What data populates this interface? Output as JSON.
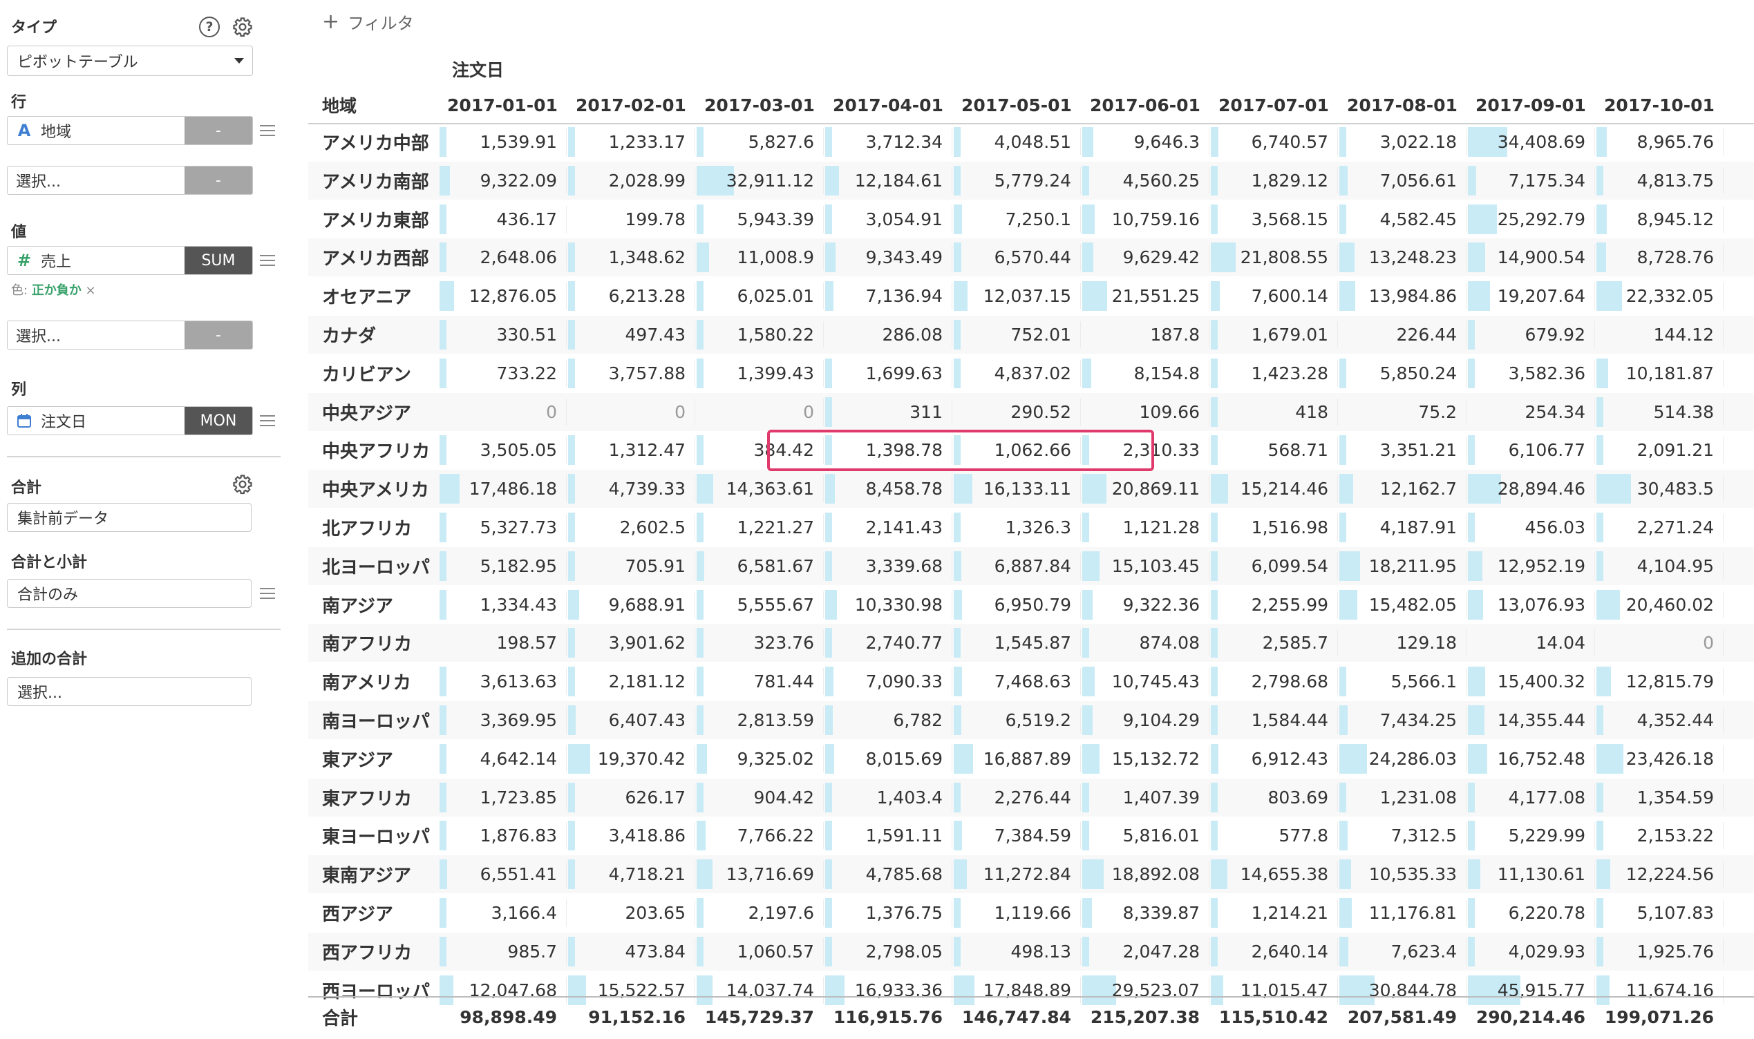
{
  "sidebar": {
    "type": {
      "label": "タイプ",
      "value": "ピボットテーブル"
    },
    "rows": {
      "label": "行",
      "field": "地域",
      "field_icon": "A",
      "field_btn": "-",
      "select_placeholder": "選択...",
      "select_btn": "-"
    },
    "values": {
      "label": "値",
      "field": "売上",
      "field_icon": "#",
      "agg": "SUM",
      "color_prefix": "色:",
      "color_value": "正か負か",
      "color_remove": "×",
      "select_placeholder": "選択...",
      "select_btn": "-"
    },
    "columns": {
      "label": "列",
      "field": "注文日",
      "agg": "MON"
    },
    "total": {
      "label": "合計",
      "value": "集計前データ"
    },
    "subtotal": {
      "label": "合計と小計",
      "value": "合計のみ"
    },
    "extra": {
      "label": "追加の合計",
      "placeholder": "選択..."
    },
    "help_glyph": "?"
  },
  "main": {
    "filter_label": "フィルタ",
    "filter_plus": "+",
    "column_group_label": "注文日",
    "row_header_label": "地域",
    "columns": [
      "2017-01-01",
      "2017-02-01",
      "2017-03-01",
      "2017-04-01",
      "2017-05-01",
      "2017-06-01",
      "2017-07-01",
      "2017-08-01",
      "2017-09-01",
      "2017-10-01"
    ],
    "rows": [
      {
        "name": "アメリカ中部",
        "values": [
          "1,539.91",
          "1,233.17",
          "5,827.6",
          "3,712.34",
          "4,048.51",
          "9,646.3",
          "6,740.57",
          "3,022.18",
          "34,408.69",
          "8,965.76"
        ]
      },
      {
        "name": "アメリカ南部",
        "values": [
          "9,322.09",
          "2,028.99",
          "32,911.12",
          "12,184.61",
          "5,779.24",
          "4,560.25",
          "1,829.12",
          "7,056.61",
          "7,175.34",
          "4,813.75"
        ]
      },
      {
        "name": "アメリカ東部",
        "values": [
          "436.17",
          "199.78",
          "5,943.39",
          "3,054.91",
          "7,250.1",
          "10,759.16",
          "3,568.15",
          "4,582.45",
          "25,292.79",
          "8,945.12"
        ]
      },
      {
        "name": "アメリカ西部",
        "values": [
          "2,648.06",
          "1,348.62",
          "11,008.9",
          "9,343.49",
          "6,570.44",
          "9,629.42",
          "21,808.55",
          "13,248.23",
          "14,900.54",
          "8,728.76"
        ]
      },
      {
        "name": "オセアニア",
        "values": [
          "12,876.05",
          "6,213.28",
          "6,025.01",
          "7,136.94",
          "12,037.15",
          "21,551.25",
          "7,600.14",
          "13,984.86",
          "19,207.64",
          "22,332.05"
        ]
      },
      {
        "name": "カナダ",
        "values": [
          "330.51",
          "497.43",
          "1,580.22",
          "286.08",
          "752.01",
          "187.8",
          "1,679.01",
          "226.44",
          "679.92",
          "144.12"
        ]
      },
      {
        "name": "カリビアン",
        "values": [
          "733.22",
          "3,757.88",
          "1,399.43",
          "1,699.63",
          "4,837.02",
          "8,154.8",
          "1,423.28",
          "5,850.24",
          "3,582.36",
          "10,181.87"
        ]
      },
      {
        "name": "中央アジア",
        "values": [
          "0",
          "0",
          "0",
          "311",
          "290.52",
          "109.66",
          "418",
          "75.2",
          "254.34",
          "514.38"
        ]
      },
      {
        "name": "中央アフリカ",
        "values": [
          "3,505.05",
          "1,312.47",
          "384.42",
          "1,398.78",
          "1,062.66",
          "2,310.33",
          "568.71",
          "3,351.21",
          "6,106.77",
          "2,091.21"
        ]
      },
      {
        "name": "中央アメリカ",
        "values": [
          "17,486.18",
          "4,739.33",
          "14,363.61",
          "8,458.78",
          "16,133.11",
          "20,869.11",
          "15,214.46",
          "12,162.7",
          "28,894.46",
          "30,483.5"
        ]
      },
      {
        "name": "北アフリカ",
        "values": [
          "5,327.73",
          "2,602.5",
          "1,221.27",
          "2,141.43",
          "1,326.3",
          "1,121.28",
          "1,516.98",
          "4,187.91",
          "456.03",
          "2,271.24"
        ]
      },
      {
        "name": "北ヨーロッパ",
        "values": [
          "5,182.95",
          "705.91",
          "6,581.67",
          "3,339.68",
          "6,887.84",
          "15,103.45",
          "6,099.54",
          "18,211.95",
          "12,952.19",
          "4,104.95"
        ]
      },
      {
        "name": "南アジア",
        "values": [
          "1,334.43",
          "9,688.91",
          "5,555.67",
          "10,330.98",
          "6,950.79",
          "9,322.36",
          "2,255.99",
          "15,482.05",
          "13,076.93",
          "20,460.02"
        ]
      },
      {
        "name": "南アフリカ",
        "values": [
          "198.57",
          "3,901.62",
          "323.76",
          "2,740.77",
          "1,545.87",
          "874.08",
          "2,585.7",
          "129.18",
          "14.04",
          "0"
        ]
      },
      {
        "name": "南アメリカ",
        "values": [
          "3,613.63",
          "2,181.12",
          "781.44",
          "7,090.33",
          "7,468.63",
          "10,745.43",
          "2,798.68",
          "5,566.1",
          "15,400.32",
          "12,815.79"
        ]
      },
      {
        "name": "南ヨーロッパ",
        "values": [
          "3,369.95",
          "6,407.43",
          "2,813.59",
          "6,782",
          "6,519.2",
          "9,104.29",
          "1,584.44",
          "7,434.25",
          "14,355.44",
          "4,352.44"
        ]
      },
      {
        "name": "東アジア",
        "values": [
          "4,642.14",
          "19,370.42",
          "9,325.02",
          "8,015.69",
          "16,887.89",
          "15,132.72",
          "6,912.43",
          "24,286.03",
          "16,752.48",
          "23,426.18"
        ]
      },
      {
        "name": "東アフリカ",
        "values": [
          "1,723.85",
          "626.17",
          "904.42",
          "1,403.4",
          "2,276.44",
          "1,407.39",
          "803.69",
          "1,231.08",
          "4,177.08",
          "1,354.59"
        ]
      },
      {
        "name": "東ヨーロッパ",
        "values": [
          "1,876.83",
          "3,418.86",
          "7,766.22",
          "1,591.11",
          "7,384.59",
          "5,816.01",
          "577.8",
          "7,312.5",
          "5,229.99",
          "2,153.22"
        ]
      },
      {
        "name": "東南アジア",
        "values": [
          "6,551.41",
          "4,718.21",
          "13,716.69",
          "4,785.68",
          "11,272.84",
          "18,892.08",
          "14,655.38",
          "10,535.33",
          "11,130.61",
          "12,224.56"
        ]
      },
      {
        "name": "西アジア",
        "values": [
          "3,166.4",
          "203.65",
          "2,197.6",
          "1,376.75",
          "1,119.66",
          "8,339.87",
          "1,214.21",
          "11,176.81",
          "6,220.78",
          "5,107.83"
        ]
      },
      {
        "name": "西アフリカ",
        "values": [
          "985.7",
          "473.84",
          "1,060.57",
          "2,798.05",
          "498.13",
          "2,047.28",
          "2,640.14",
          "7,623.4",
          "4,029.93",
          "1,925.76"
        ]
      },
      {
        "name": "西ヨーロッパ",
        "values": [
          "12,047.68",
          "15,522.57",
          "14,037.74",
          "16,933.36",
          "17,848.89",
          "29,523.07",
          "11,015.47",
          "30,844.78",
          "45,915.77",
          "11,674.16"
        ]
      }
    ],
    "total": {
      "name": "合計",
      "values": [
        "98,898.49",
        "91,152.16",
        "145,729.37",
        "116,915.76",
        "146,747.84",
        "215,207.38",
        "115,510.42",
        "207,581.49",
        "290,214.46",
        "199,071.26"
      ]
    },
    "bar_max": 45915.77,
    "bar_color": "#c9ebf6",
    "highlight_color": "#e03a6c"
  }
}
